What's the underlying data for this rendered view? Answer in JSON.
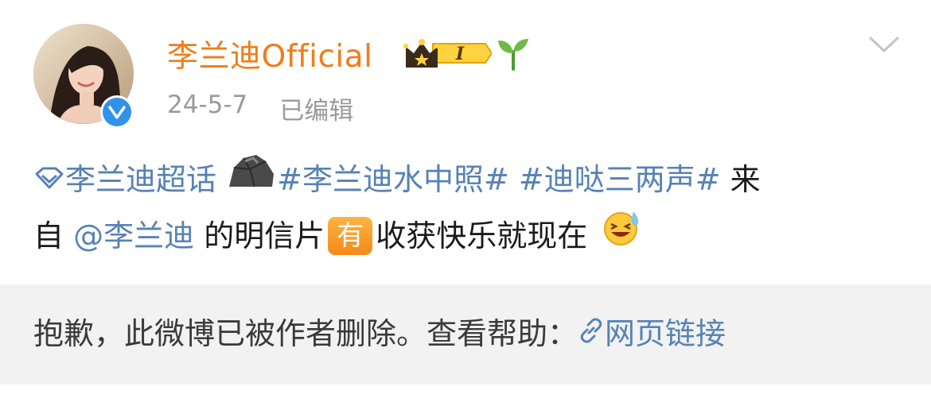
{
  "post": {
    "username": "李兰迪Official",
    "date": "24-5-7",
    "edited_label": "已编辑",
    "badges": [
      "crown-level-badge",
      "sprout-icon"
    ],
    "badge_level": "I",
    "content": {
      "supertopic": "李兰迪超话",
      "hashtag1": "#李兰迪水中照#",
      "hashtag2": "#迪哒三两声#",
      "text1": " 来",
      "text2": "自",
      "mention": "@李兰迪",
      "text3": " 的明信片",
      "you_badge": "有",
      "text4": "收获快乐就现在"
    }
  },
  "notice": {
    "text": "抱歉，此微博已被作者删除。查看帮助：",
    "link_label": "网页链接"
  },
  "colors": {
    "username": "#f07d18",
    "link": "#5682b6",
    "meta": "#9a9a9a",
    "notice_bg": "#f2f2f2",
    "verify": "#2f93ea"
  }
}
